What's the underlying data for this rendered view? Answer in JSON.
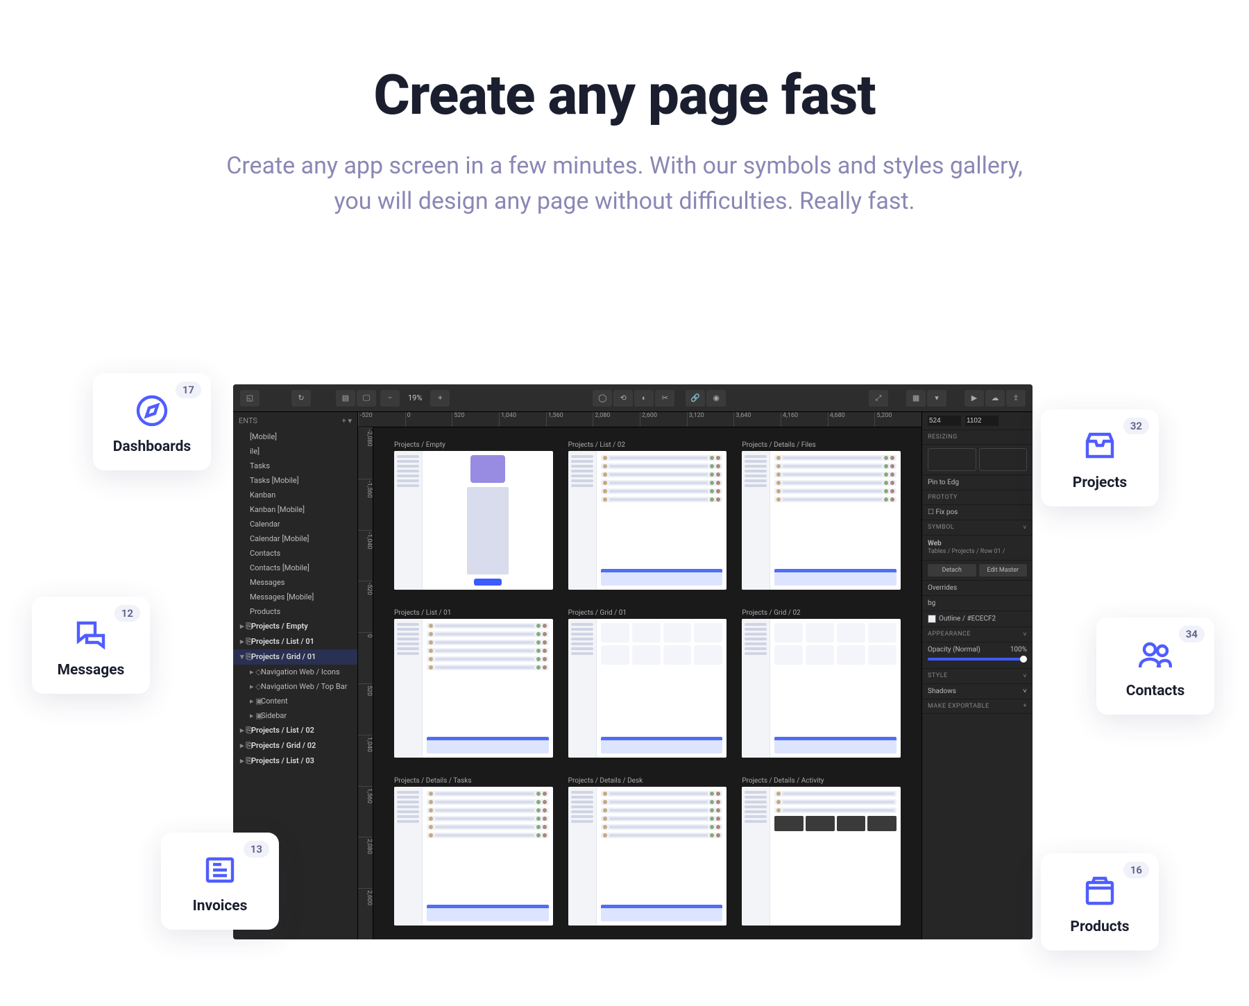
{
  "hero": {
    "title": "Create any page fast",
    "subtitle1": "Create any app screen in a few minutes. With our symbols and styles gallery,",
    "subtitle2": "you will design any page without difficulties. Really fast."
  },
  "editor": {
    "zoom": "19%",
    "layers_header": "ENTS",
    "layers": [
      {
        "l": "[Mobile]",
        "d": 1
      },
      {
        "l": "ile]",
        "d": 1
      },
      {
        "l": "Tasks",
        "d": 1
      },
      {
        "l": "Tasks [Mobile]",
        "d": 1
      },
      {
        "l": "Kanban",
        "d": 1
      },
      {
        "l": "Kanban [Mobile]",
        "d": 1
      },
      {
        "l": "Calendar",
        "d": 1
      },
      {
        "l": "Calendar [Mobile]",
        "d": 1
      },
      {
        "l": "Contacts",
        "d": 1
      },
      {
        "l": "Contacts [Mobile]",
        "d": 1
      },
      {
        "l": "Messages",
        "d": 1
      },
      {
        "l": "Messages [Mobile]",
        "d": 1
      },
      {
        "l": "Products",
        "d": 1
      },
      {
        "l": "Projects / Empty",
        "d": 0,
        "b": true,
        "ic": "▸ ⎘"
      },
      {
        "l": "Projects / List / 01",
        "d": 0,
        "b": true,
        "ic": "▸ ⎘"
      },
      {
        "l": "Projects / Grid / 01",
        "d": 0,
        "b": true,
        "sel": true,
        "ic": "▾ ⎘"
      },
      {
        "l": "Navigation Web / Icons",
        "d": 1,
        "ic": "▸ ◇"
      },
      {
        "l": "Navigation Web / Top Bar",
        "d": 1,
        "ic": "▸ ◇"
      },
      {
        "l": "Content",
        "d": 1,
        "ic": "▸ ▣"
      },
      {
        "l": "Sidebar",
        "d": 1,
        "ic": "▸ ▣"
      },
      {
        "l": "Projects / List / 02",
        "d": 0,
        "b": true,
        "ic": "▸ ⎘"
      },
      {
        "l": "Projects / Grid / 02",
        "d": 0,
        "b": true,
        "ic": "▸ ⎘"
      },
      {
        "l": "Projects / List / 03",
        "d": 0,
        "b": true,
        "ic": "▸ ⎘"
      }
    ],
    "ruler_h": [
      "-520",
      "0",
      "520",
      "1,040",
      "1,560",
      "2,080",
      "2,600",
      "3,120",
      "3,640",
      "4,160",
      "4,680",
      "5,200"
    ],
    "ruler_v": [
      "-2,080",
      "-1,560",
      "-1,040",
      "-520",
      "0",
      "520",
      "1,040",
      "1,560",
      "2,080",
      "2,600"
    ],
    "artboards": [
      "Projects / Empty",
      "Projects / List / 02",
      "Projects / Details / Files",
      "Projects / List / 01",
      "Projects / Grid / 01",
      "Projects / Grid / 02",
      "Projects / Details / Tasks",
      "Projects / Details / Desk",
      "Projects / Details / Activity"
    ],
    "inspector": {
      "w": "524",
      "h": "1102",
      "resizing": "RESIZING",
      "pin": "Pin to Edg",
      "proto": "PROTOTY",
      "fixpos": "Fix pos",
      "symbol_head": "SYMBOL",
      "symbol_name": "Web",
      "symbol_path": "Tables / Projects / Row 01 /",
      "detach": "Detach",
      "edit_master": "Edit Master",
      "overrides": "Overrides",
      "bg": "bg",
      "color_label": "Outline / #ECECF2",
      "appearance": "APPEARANCE",
      "opacity_label": "Opacity (Normal)",
      "opacity_val": "100%",
      "style": "STYLE",
      "shadows": "Shadows",
      "export": "MAKE EXPORTABLE"
    }
  },
  "cards": {
    "dashboards": {
      "label": "Dashboards",
      "count": "17"
    },
    "projects": {
      "label": "Projects",
      "count": "32"
    },
    "messages": {
      "label": "Messages",
      "count": "12"
    },
    "contacts": {
      "label": "Contacts",
      "count": "34"
    },
    "invoices": {
      "label": "Invoices",
      "count": "13"
    },
    "products": {
      "label": "Products",
      "count": "16"
    }
  }
}
